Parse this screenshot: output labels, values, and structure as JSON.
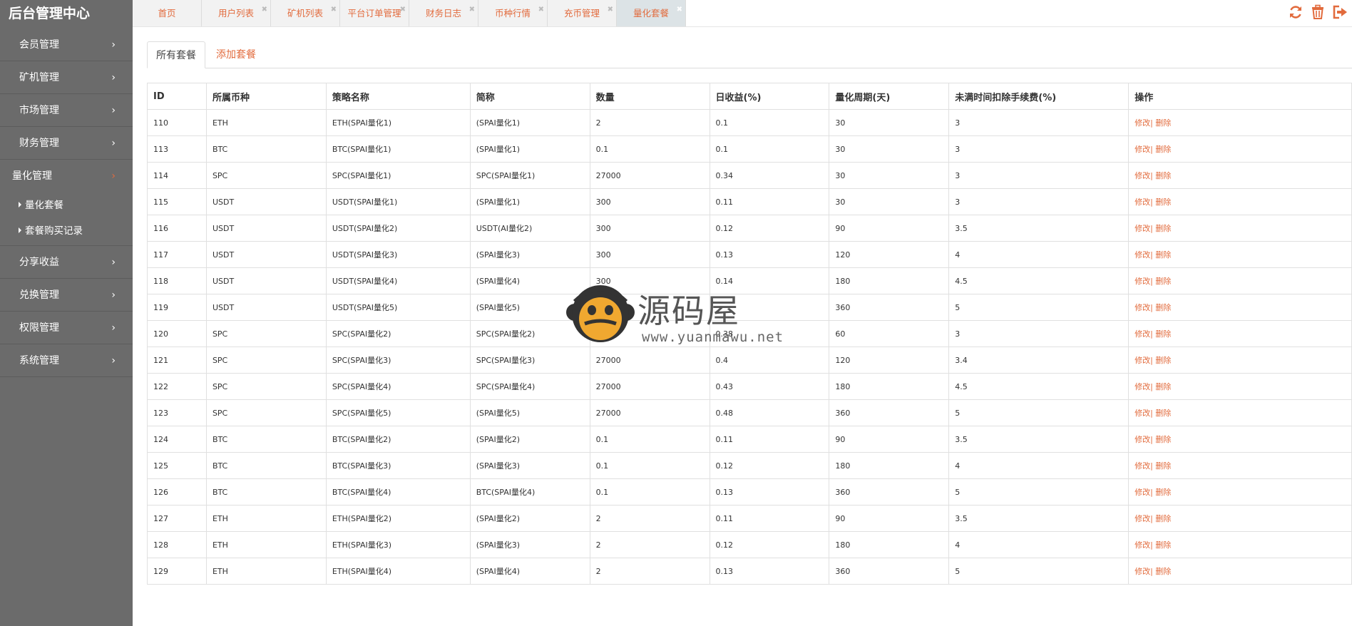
{
  "app": {
    "title": "后台管理中心"
  },
  "sidebar": {
    "items": [
      {
        "label": "会员管理"
      },
      {
        "label": "矿机管理"
      },
      {
        "label": "市场管理"
      },
      {
        "label": "财务管理"
      },
      {
        "label": "量化管理",
        "active": true,
        "children": [
          {
            "label": "量化套餐"
          },
          {
            "label": "套餐购买记录"
          }
        ]
      },
      {
        "label": "分享收益"
      },
      {
        "label": "兑换管理"
      },
      {
        "label": "权限管理"
      },
      {
        "label": "系统管理"
      }
    ]
  },
  "tabs": [
    {
      "label": "首页"
    },
    {
      "label": "用户列表"
    },
    {
      "label": "矿机列表"
    },
    {
      "label": "平台订单管理"
    },
    {
      "label": "财务日志"
    },
    {
      "label": "币种行情"
    },
    {
      "label": "充币管理"
    },
    {
      "label": "量化套餐",
      "active": true
    }
  ],
  "top_icons": [
    "refresh-icon",
    "trash-icon",
    "logout-icon"
  ],
  "subtabs": {
    "active": "所有套餐",
    "link": "添加套餐"
  },
  "table": {
    "headers": [
      "ID",
      "所属币种",
      "策略名称",
      "简称",
      "数量",
      "日收益(%)",
      "量化周期(天)",
      "未满时间扣除手续费(%)",
      "操作"
    ],
    "op_edit": "修改|",
    "op_delete": " 删除",
    "rows": [
      [
        "110",
        "ETH",
        "ETH(SPAI量化1)",
        "(SPAI量化1)",
        "2",
        "0.1",
        "30",
        "3"
      ],
      [
        "113",
        "BTC",
        "BTC(SPAI量化1)",
        "(SPAI量化1)",
        "0.1",
        "0.1",
        "30",
        "3"
      ],
      [
        "114",
        "SPC",
        "SPC(SPAI量化1)",
        "SPC(SPAI量化1)",
        "27000",
        "0.34",
        "30",
        "3"
      ],
      [
        "115",
        "USDT",
        "USDT(SPAI量化1)",
        "(SPAI量化1)",
        "300",
        "0.11",
        "30",
        "3"
      ],
      [
        "116",
        "USDT",
        "USDT(SPAI量化2)",
        "USDT(AI量化2)",
        "300",
        "0.12",
        "90",
        "3.5"
      ],
      [
        "117",
        "USDT",
        "USDT(SPAI量化3)",
        "(SPAI量化3)",
        "300",
        "0.13",
        "120",
        "4"
      ],
      [
        "118",
        "USDT",
        "USDT(SPAI量化4)",
        "(SPAI量化4)",
        "300",
        "0.14",
        "180",
        "4.5"
      ],
      [
        "119",
        "USDT",
        "USDT(SPAI量化5)",
        "(SPAI量化5)",
        "",
        "",
        "360",
        "5"
      ],
      [
        "120",
        "SPC",
        "SPC(SPAI量化2)",
        "SPC(SPAI量化2)",
        "",
        "0.38",
        "60",
        "3"
      ],
      [
        "121",
        "SPC",
        "SPC(SPAI量化3)",
        "SPC(SPAI量化3)",
        "27000",
        "0.4",
        "120",
        "3.4"
      ],
      [
        "122",
        "SPC",
        "SPC(SPAI量化4)",
        "SPC(SPAI量化4)",
        "27000",
        "0.43",
        "180",
        "4.5"
      ],
      [
        "123",
        "SPC",
        "SPC(SPAI量化5)",
        "(SPAI量化5)",
        "27000",
        "0.48",
        "360",
        "5"
      ],
      [
        "124",
        "BTC",
        "BTC(SPAI量化2)",
        "(SPAI量化2)",
        "0.1",
        "0.11",
        "90",
        "3.5"
      ],
      [
        "125",
        "BTC",
        "BTC(SPAI量化3)",
        "(SPAI量化3)",
        "0.1",
        "0.12",
        "180",
        "4"
      ],
      [
        "126",
        "BTC",
        "BTC(SPAI量化4)",
        "BTC(SPAI量化4)",
        "0.1",
        "0.13",
        "360",
        "5"
      ],
      [
        "127",
        "ETH",
        "ETH(SPAI量化2)",
        "(SPAI量化2)",
        "2",
        "0.11",
        "90",
        "3.5"
      ],
      [
        "128",
        "ETH",
        "ETH(SPAI量化3)",
        "(SPAI量化3)",
        "2",
        "0.12",
        "180",
        "4"
      ],
      [
        "129",
        "ETH",
        "ETH(SPAI量化4)",
        "(SPAI量化4)",
        "2",
        "0.13",
        "360",
        "5"
      ]
    ]
  },
  "watermark": {
    "title": "源码屋",
    "url": "www.yuanmawu.net"
  },
  "colors": {
    "accent": "#e26b3d",
    "sidebar_bg": "#6b6b6b"
  }
}
